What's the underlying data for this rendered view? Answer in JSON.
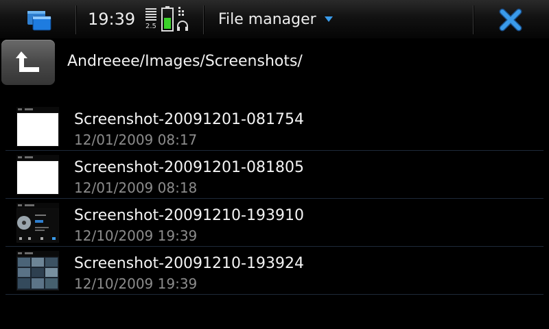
{
  "statusbar": {
    "clock": "19:39",
    "network_label": "2.5",
    "app_title": "File manager",
    "accent_color": "#3a9bea",
    "icons": {
      "task_switcher": "task-switcher-icon",
      "battery": "battery-icon",
      "signal": "signal-strength-icon",
      "headphones": "headphones-icon",
      "close": "close-icon",
      "menu_arrow": "dropdown-arrow-icon"
    }
  },
  "header": {
    "up_icon": "up-arrow-icon",
    "path": "Andreeee/Images/Screenshots/"
  },
  "files": [
    {
      "name": "Screenshot-20091201-081754",
      "date": "12/01/2009 08:17"
    },
    {
      "name": "Screenshot-20091201-081805",
      "date": "12/01/2009 08:18"
    },
    {
      "name": "Screenshot-20091210-193910",
      "date": "12/10/2009 19:39"
    },
    {
      "name": "Screenshot-20091210-193924",
      "date": "12/10/2009 19:39"
    }
  ]
}
